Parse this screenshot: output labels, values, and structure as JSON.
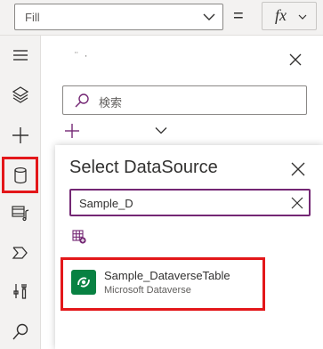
{
  "formula_bar": {
    "property_value": "Fill",
    "equals": "=",
    "fx_label": "fx"
  },
  "rail": {
    "items": [
      {
        "icon": "hamburger-icon"
      },
      {
        "icon": "layers-icon"
      },
      {
        "icon": "plus-icon"
      },
      {
        "icon": "database-icon",
        "active": true
      },
      {
        "icon": "media-icon"
      },
      {
        "icon": "power-automate-icon"
      },
      {
        "icon": "tools-icon"
      },
      {
        "icon": "search-icon"
      }
    ]
  },
  "panel": {
    "title": "¨ ·",
    "search_placeholder": "検索"
  },
  "flyout": {
    "title": "Select DataSource",
    "search_value": "Sample_D",
    "result": {
      "name": "Sample_DataverseTable",
      "source": "Microsoft Dataverse"
    }
  },
  "colors": {
    "highlight": "#e3171a",
    "focus": "#742774",
    "dataverse": "#088142"
  }
}
